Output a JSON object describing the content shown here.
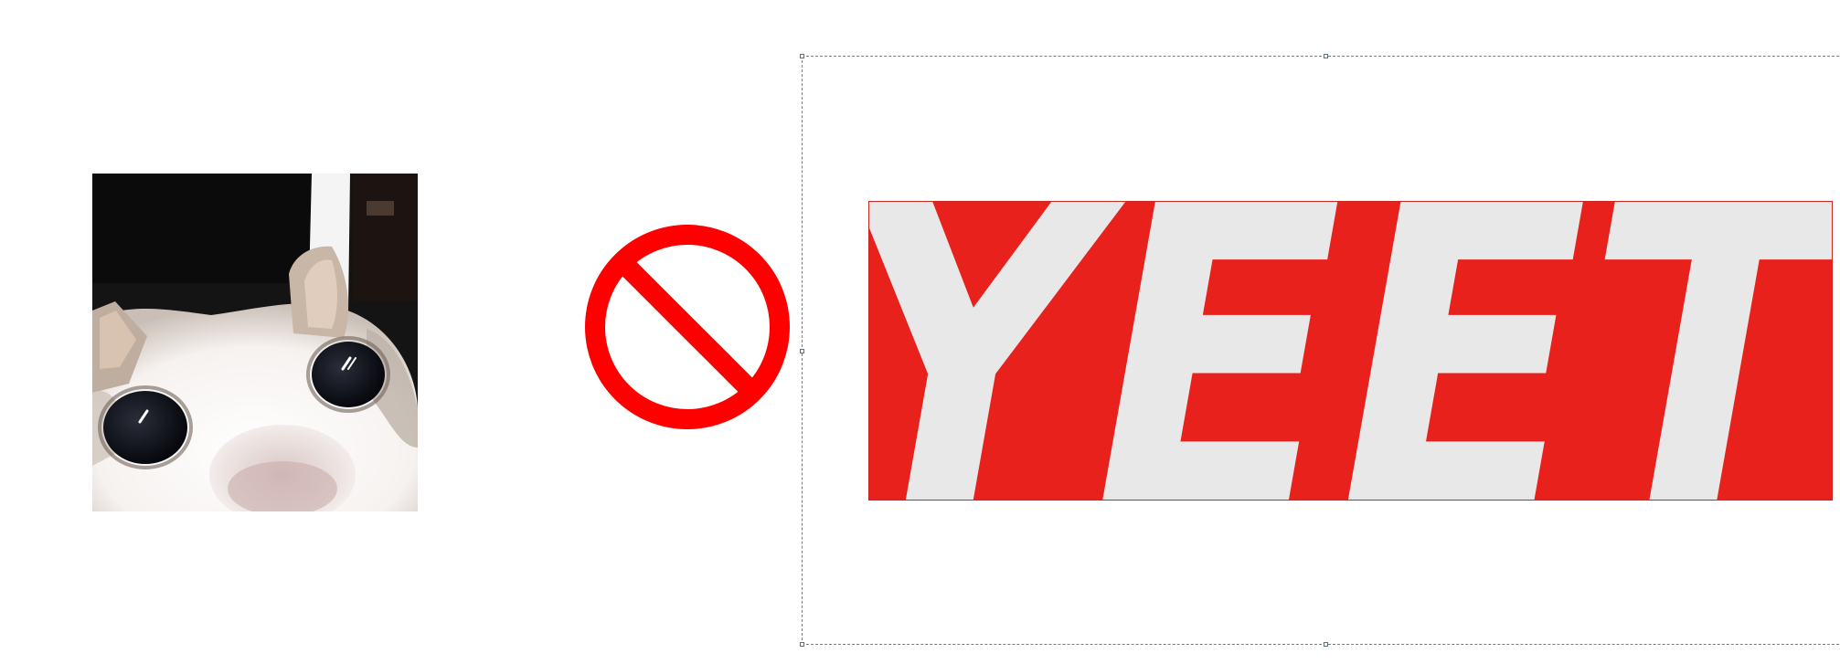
{
  "canvas": {
    "background": "#ffffff"
  },
  "image_left": {
    "icon": "cat-face-photo"
  },
  "prohibition_sign": {
    "icon": "no-sign-icon",
    "color": "#ff0000"
  },
  "selection": {
    "frame_color": "#3f8fc4",
    "state": "selected"
  },
  "banner": {
    "text": "YEET",
    "background": "#e8211d",
    "text_color": "#e8e8e8"
  }
}
